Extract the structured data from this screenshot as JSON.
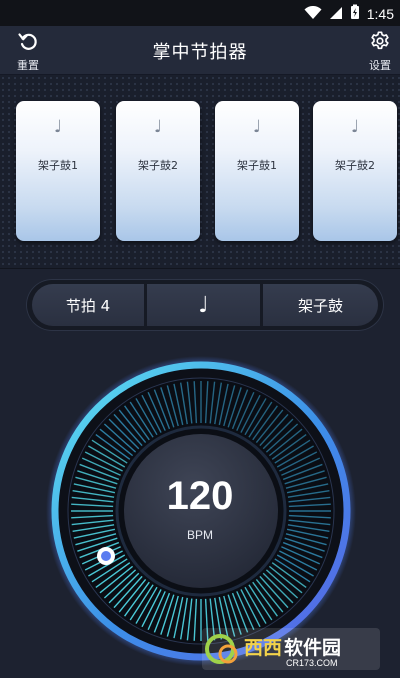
{
  "status_bar": {
    "time": "1:45"
  },
  "header": {
    "title": "掌中节拍器",
    "reset_label": "重置",
    "settings_label": "设置"
  },
  "pads": [
    {
      "note": "♩",
      "label": "架子鼓1"
    },
    {
      "note": "♩",
      "label": "架子鼓2"
    },
    {
      "note": "♩",
      "label": "架子鼓1"
    },
    {
      "note": "♩",
      "label": "架子鼓2"
    }
  ],
  "selector": {
    "beat": "节拍 4",
    "note": "♩",
    "sound": "架子鼓"
  },
  "tempo": {
    "value": "120",
    "unit": "BPM"
  },
  "watermark": {
    "brand": "西西软件园",
    "domain": "CR173.COM"
  },
  "colors": {
    "background": "#1d2230",
    "title_bar": "#242a3a",
    "accent_cyan": "#3fd6e6",
    "accent_blue": "#4a78e8"
  }
}
